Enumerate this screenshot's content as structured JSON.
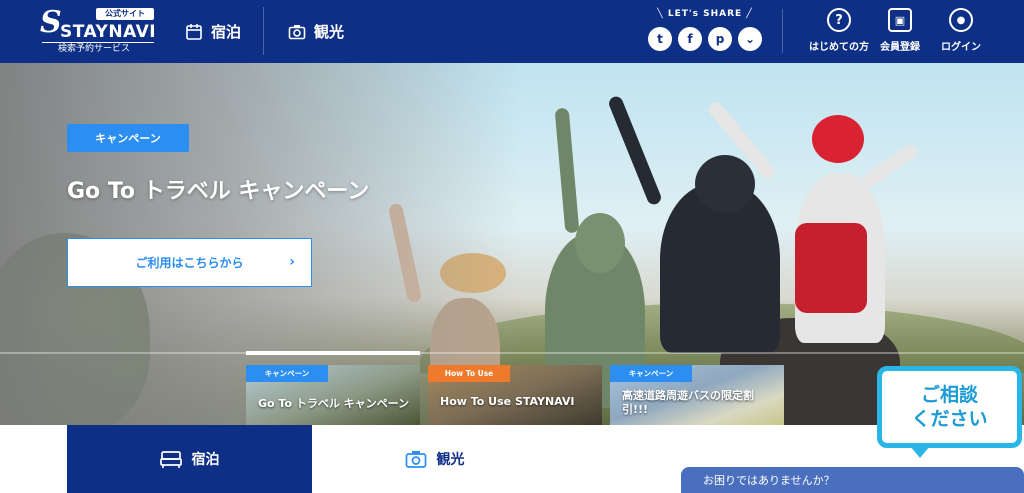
{
  "header": {
    "logo": {
      "badge": "公式サイト",
      "name": "STAYNAVI",
      "subtitle": "検索予約サービス"
    },
    "nav": [
      {
        "label": "宿泊",
        "icon": "calendar-icon"
      },
      {
        "label": "観光",
        "icon": "camera-icon"
      }
    ],
    "share": {
      "label": "╲ LET's SHARE ╱",
      "buttons": [
        {
          "icon": "twitter-icon",
          "glyph": "t"
        },
        {
          "icon": "facebook-icon",
          "glyph": "f"
        },
        {
          "icon": "pinterest-icon",
          "glyph": "p"
        },
        {
          "icon": "pocket-icon",
          "glyph": "⌄"
        }
      ]
    },
    "links": [
      {
        "label": "はじめての方",
        "icon": "question-icon",
        "glyph": "?"
      },
      {
        "label": "会員登録",
        "icon": "member-card-icon",
        "glyph": "▣"
      },
      {
        "label": "ログイン",
        "icon": "user-icon",
        "glyph": "●"
      }
    ]
  },
  "hero": {
    "tag": "キャンペーン",
    "title": "Go To トラベル キャンペーン",
    "cta_label": "ご利用はこちらから",
    "cta_arrow": "›"
  },
  "thumbnails": [
    {
      "tag": "キャンペーン",
      "tag_color": "#2b8ef0",
      "title": "Go To トラベル キャンペーン"
    },
    {
      "tag": "How To Use",
      "tag_color": "#f07a2b",
      "title": "How To Use STAYNAVI"
    },
    {
      "tag": "キャンペーン",
      "tag_color": "#2b8ef0",
      "title": "高速道路周遊バスの限定割引!!!"
    }
  ],
  "tabs": [
    {
      "label": "宿泊",
      "icon": "bed-icon",
      "active": true
    },
    {
      "label": "観光",
      "icon": "camera-icon",
      "active": false
    }
  ],
  "consult": {
    "line1": "ご相談",
    "line2": "ください"
  },
  "chat": {
    "label": "お困りではありませんか？"
  },
  "colors": {
    "brand": "#0e2f86",
    "accent": "#2b8ef0",
    "consult": "#29b6e6",
    "chat": "#4a6fbf"
  }
}
